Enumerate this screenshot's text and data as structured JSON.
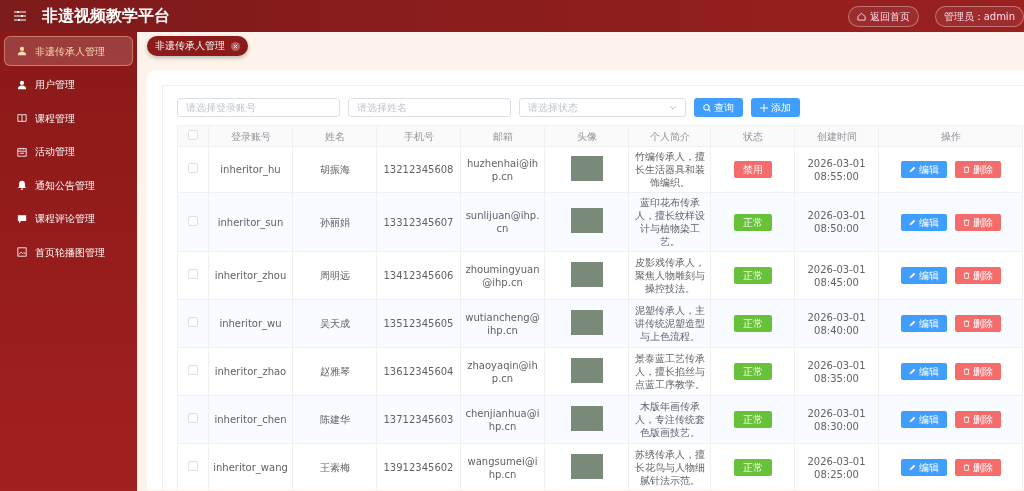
{
  "header": {
    "title": "非遗视频教学平台",
    "home_button": "返回首页",
    "user_label": "管理员：admin"
  },
  "sidebar": {
    "items": [
      {
        "label": "非遗传承人管理",
        "selected": true
      },
      {
        "label": "用户管理",
        "selected": false
      },
      {
        "label": "课程管理",
        "selected": false
      },
      {
        "label": "活动管理",
        "selected": false
      },
      {
        "label": "通知公告管理",
        "selected": false
      },
      {
        "label": "课程评论管理",
        "selected": false
      },
      {
        "label": "首页轮播图管理",
        "selected": false
      }
    ]
  },
  "tabs": [
    {
      "label": "非遗传承人管理",
      "selected": true
    }
  ],
  "filters": {
    "fields": [
      {
        "kind": "text",
        "placeholder": "请选择登录账号"
      },
      {
        "kind": "text",
        "placeholder": "请选择姓名"
      },
      {
        "kind": "select",
        "placeholder": "请选择状态"
      }
    ],
    "search_button": "查询",
    "add_button": "添加"
  },
  "table": {
    "header_checked": false,
    "columns": [
      "登录账号",
      "姓名",
      "手机号",
      "邮箱",
      "头像",
      "个人简介",
      "状态",
      "创建时间",
      "操作"
    ],
    "rows": [
      {
        "checked": false,
        "account": "inheritor_hu",
        "name": "胡振海",
        "phone": "13212345608",
        "email": "huzhenhai@ihp.cn",
        "profile": "竹编传承人，擅长生活器具和装饰编织。",
        "status": {
          "kind": "disabled",
          "label": "禁用"
        },
        "created": "2026-03-01 08:55:00",
        "edit": "编辑",
        "delete": "删除"
      },
      {
        "checked": false,
        "account": "inheritor_sun",
        "name": "孙丽娟",
        "phone": "13312345607",
        "email": "sunlijuan@ihp.cn",
        "profile": "蓝印花布传承人，擅长纹样设计与植物染工艺。",
        "status": {
          "kind": "enabled",
          "label": "正常"
        },
        "created": "2026-03-01 08:50:00",
        "edit": "编辑",
        "delete": "删除"
      },
      {
        "checked": false,
        "account": "inheritor_zhou",
        "name": "周明远",
        "phone": "13412345606",
        "email": "zhoumingyuan@ihp.cn",
        "profile": "皮影戏传承人，聚焦人物雕刻与操控技法。",
        "status": {
          "kind": "enabled",
          "label": "正常"
        },
        "created": "2026-03-01 08:45:00",
        "edit": "编辑",
        "delete": "删除"
      },
      {
        "checked": false,
        "account": "inheritor_wu",
        "name": "吴天成",
        "phone": "13512345605",
        "email": "wutiancheng@ihp.cn",
        "profile": "泥塑传承人，主讲传统泥塑造型与上色流程。",
        "status": {
          "kind": "enabled",
          "label": "正常"
        },
        "created": "2026-03-01 08:40:00",
        "edit": "编辑",
        "delete": "删除"
      },
      {
        "checked": false,
        "account": "inheritor_zhao",
        "name": "赵雅琴",
        "phone": "13612345604",
        "email": "zhaoyaqin@ihp.cn",
        "profile": "景泰蓝工艺传承人，擅长掐丝与点蓝工序教学。",
        "status": {
          "kind": "enabled",
          "label": "正常"
        },
        "created": "2026-03-01 08:35:00",
        "edit": "编辑",
        "delete": "删除"
      },
      {
        "checked": false,
        "account": "inheritor_chen",
        "name": "陈建华",
        "phone": "13712345603",
        "email": "chenjianhua@ihp.cn",
        "profile": "木版年画传承人，专注传统套色版画技艺。",
        "status": {
          "kind": "enabled",
          "label": "正常"
        },
        "created": "2026-03-01 08:30:00",
        "edit": "编辑",
        "delete": "删除"
      },
      {
        "checked": false,
        "account": "inheritor_wang",
        "name": "王素梅",
        "phone": "13912345602",
        "email": "wangsumei@ihp.cn",
        "profile": "苏绣传承人，擅长花鸟与人物细腻针法示范。",
        "status": {
          "kind": "enabled",
          "label": "正常"
        },
        "created": "2026-03-01 08:25:00",
        "edit": "编辑",
        "delete": "删除"
      }
    ]
  }
}
